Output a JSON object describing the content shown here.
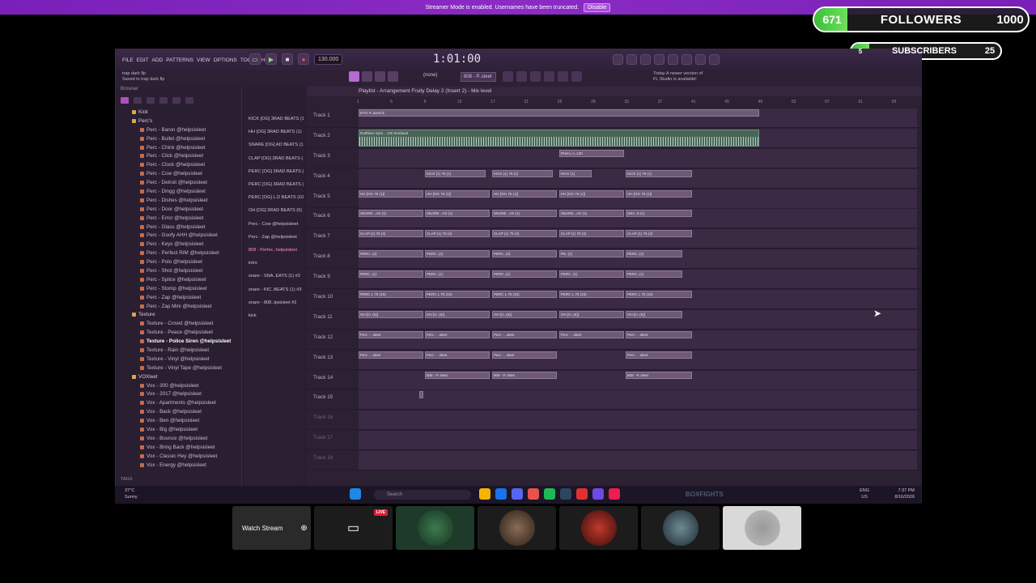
{
  "banner": {
    "text": "Streamer Mode is enabled. Usernames have been truncated.",
    "button": "Disable"
  },
  "followers": {
    "count": "671",
    "label": "FOLLOWERS",
    "goal": "1000",
    "progress": 0.671
  },
  "subscribers": {
    "count": "5",
    "label": "SUBSCRIBERS",
    "goal": "25",
    "progress": 0.2
  },
  "menu": [
    "FILE",
    "EDIT",
    "ADD",
    "PATTERNS",
    "VIEW",
    "OPTIONS",
    "TOOLS",
    "HELP"
  ],
  "transport": {
    "tempo": "130.000",
    "time": "1:01:00",
    "pattern": "808 - P..sleet",
    "snap": "(none)"
  },
  "hint": {
    "line1": "trap dark flp",
    "line2": "Saved to trap dark flp"
  },
  "news": {
    "line1": "Today  A newer version of",
    "line2": "FL Studio is available!"
  },
  "playlist": {
    "title": "Playlist - Arrangement  Fruity Delay 2 (Insert 2) - Mix level"
  },
  "browser": {
    "header": "Browser",
    "footer": "TAGS",
    "items": [
      {
        "label": "Kick",
        "type": "folder"
      },
      {
        "label": "Perc's",
        "type": "folder"
      },
      {
        "label": "Perc - Baron @helpsisleet",
        "type": "file"
      },
      {
        "label": "Perc - Bullet @helpsisleet",
        "type": "file"
      },
      {
        "label": "Perc - Chink @helpsisleet",
        "type": "file"
      },
      {
        "label": "Perc - Click @helpsisleet",
        "type": "file"
      },
      {
        "label": "Perc - Clock @helpsisleet",
        "type": "file"
      },
      {
        "label": "Perc - Cow @helpsisleet",
        "type": "file"
      },
      {
        "label": "Perc - Detroit @helpsisleet",
        "type": "file"
      },
      {
        "label": "Perc - Dingg @helpsisleet",
        "type": "file"
      },
      {
        "label": "Perc - Dishes @helpsisleet",
        "type": "file"
      },
      {
        "label": "Perc - Door @helpsisleet",
        "type": "file"
      },
      {
        "label": "Perc - Error @helpsisleet",
        "type": "file"
      },
      {
        "label": "Perc - Glass @helpsisleet",
        "type": "file"
      },
      {
        "label": "Perc - Goofy AHH @helpsisleet",
        "type": "file"
      },
      {
        "label": "Perc - Keys @helpsisleet",
        "type": "file"
      },
      {
        "label": "Perc - Perfect RIM @helpsisleet",
        "type": "file"
      },
      {
        "label": "Perc - Polo @helpsisleet",
        "type": "file"
      },
      {
        "label": "Perc - Shot @helpsisleet",
        "type": "file"
      },
      {
        "label": "Perc - Splice @helpsisleet",
        "type": "file"
      },
      {
        "label": "Perc - Stomp @helpsisleet",
        "type": "file"
      },
      {
        "label": "Perc - Zap @helpsisleet",
        "type": "file"
      },
      {
        "label": "Perc - Zap Mini @helpsisleet",
        "type": "file"
      },
      {
        "label": "Texture",
        "type": "folder"
      },
      {
        "label": "Texture - Crowd @helpsisleet",
        "type": "file"
      },
      {
        "label": "Texture - Peace @helpsisleet",
        "type": "file"
      },
      {
        "label": "Texture - Police Siren @helpsisleet",
        "type": "selected"
      },
      {
        "label": "Texture - Rain @helpsisleet",
        "type": "file"
      },
      {
        "label": "Texture - Vinyl @helpsisleet",
        "type": "file"
      },
      {
        "label": "Texture - Vinyl Tape @helpsisleet",
        "type": "file"
      },
      {
        "label": "VOXleet",
        "type": "folder"
      },
      {
        "label": "Vox - 300 @helpsisleet",
        "type": "file"
      },
      {
        "label": "Vox - 2017 @helpsisleet",
        "type": "file"
      },
      {
        "label": "Vox - Apartments @helpsisleet",
        "type": "file"
      },
      {
        "label": "Vox - Back @helpsisleet",
        "type": "file"
      },
      {
        "label": "Vox - Ben @helpsisleet",
        "type": "file"
      },
      {
        "label": "Vox - Big @helpsisleet",
        "type": "file"
      },
      {
        "label": "Vox - Bounce @helpsisleet",
        "type": "file"
      },
      {
        "label": "Vox - Bring Back @helpsisleet",
        "type": "file"
      },
      {
        "label": "Vox - Classic Hey @helpsisleet",
        "type": "file"
      },
      {
        "label": "Vox - Energy @helpsisleet",
        "type": "file"
      }
    ]
  },
  "patterns": [
    "KICK [OG] 3RAD BEATS (1)",
    "HH [OG] 3RAD BEATS (1)",
    "SNARE [OG] AD BEATS (1)",
    "CLAP [OG] 3RAD BEATS (1)",
    "PERC [OG] 3RAD BEATS (2)",
    "PERC [OG] 3RAD BEATS (1)",
    "PERC [OG] L.D BEATS (10)",
    "OH [OG] 3RAD BEATS (6)",
    "Perc - Cow @helpsisleet",
    "Perc - Zap @helpsisleet",
    "808 - Perfec..helpsisleet",
    "intro",
    "snare - SNA..EATS (1) #2",
    "snare - KIC..BEATS (1) #3",
    "snare - 808..lpsisleet #2",
    "kick"
  ],
  "timeline": [
    "1",
    "5",
    "9",
    "13",
    "17",
    "21",
    "25",
    "29",
    "33",
    "37",
    "41",
    "45",
    "49",
    "53",
    "57",
    "61",
    "65"
  ],
  "tracks": [
    {
      "label": "Track 1",
      "clips": [
        [
          "DTG P..averick",
          0,
          495,
          "plain"
        ]
      ]
    },
    {
      "label": "Track 2",
      "clips": [
        [
          "Ruthless Synt... 130 Zembunt",
          0,
          495,
          "audio"
        ]
      ]
    },
    {
      "label": "Track 3",
      "clips": [
        [
          "Premi..n..130",
          248,
          80,
          "plain"
        ]
      ]
    },
    {
      "label": "Track 4",
      "clips": [
        [
          "KICK (1) 75 (1)",
          82,
          75,
          "plain"
        ],
        [
          "KICK (1) 75 (1)",
          165,
          75,
          "plain"
        ],
        [
          "KICK (1)",
          248,
          40,
          "plain"
        ],
        [
          "KICK (1) 75 (1)",
          330,
          82,
          "plain"
        ]
      ]
    },
    {
      "label": "Track 5",
      "clips": [
        [
          "HH [OG 75 (1)]",
          0,
          80,
          "plain"
        ],
        [
          "HH [OG 75 (1)]",
          82,
          80,
          "plain"
        ],
        [
          "HH [OG 75 (1)]",
          165,
          80,
          "plain"
        ],
        [
          "HH [OG 75 (1)]",
          248,
          80,
          "plain"
        ],
        [
          "HH [OG 75 (1)]",
          330,
          82,
          "plain"
        ]
      ]
    },
    {
      "label": "Track 6",
      "clips": [
        [
          "SNARE ..AS (1)",
          0,
          80,
          "plain"
        ],
        [
          "SNARE ..AS (1)",
          82,
          80,
          "plain"
        ],
        [
          "SNARE ..AS (1)",
          165,
          80,
          "plain"
        ],
        [
          "SNARE ..AS (1)",
          248,
          80,
          "plain"
        ],
        [
          "SNA..S (1)",
          330,
          82,
          "plain"
        ]
      ]
    },
    {
      "label": "Track 7",
      "clips": [
        [
          "CLAP (1) 75 (4)",
          0,
          80,
          "plain"
        ],
        [
          "CLAP (1) 75 (4)",
          82,
          80,
          "plain"
        ],
        [
          "CLAP (1) 75 (4)",
          165,
          80,
          "plain"
        ],
        [
          "CLAP (1) 75 (4)",
          248,
          80,
          "plain"
        ],
        [
          "CLAP (1) 75 (4)",
          330,
          82,
          "plain"
        ]
      ]
    },
    {
      "label": "Track 8",
      "clips": [
        [
          "PERC..(2)",
          0,
          80,
          "plain"
        ],
        [
          "PERC..(2)",
          82,
          80,
          "plain"
        ],
        [
          "PERC..(2)",
          165,
          80,
          "plain"
        ],
        [
          "PE..(2)",
          248,
          80,
          "plain"
        ],
        [
          "PERC..(2)",
          330,
          70,
          "plain"
        ]
      ]
    },
    {
      "label": "Track 9",
      "clips": [
        [
          "PERC..(1)",
          0,
          80,
          "plain"
        ],
        [
          "PERC..(1)",
          82,
          80,
          "plain"
        ],
        [
          "PERC..(1)",
          165,
          80,
          "plain"
        ],
        [
          "PERC..(1)",
          248,
          80,
          "plain"
        ],
        [
          "PERC..(1)",
          330,
          70,
          "plain"
        ]
      ]
    },
    {
      "label": "Track 10",
      "clips": [
        [
          "PERC L 75 (10)",
          0,
          80,
          "plain"
        ],
        [
          "PERC L 75 (10)",
          82,
          80,
          "plain"
        ],
        [
          "PERC L 75 (10)",
          165,
          80,
          "plain"
        ],
        [
          "PERC L 75 (10)",
          248,
          80,
          "plain"
        ],
        [
          "PERC L 75 (10)",
          330,
          82,
          "plain"
        ]
      ]
    },
    {
      "label": "Track 11",
      "clips": [
        [
          "OH [O..(6)]",
          0,
          80,
          "plain"
        ],
        [
          "OH [O..(6)]",
          82,
          80,
          "plain"
        ],
        [
          "OH [O..(6)]",
          165,
          80,
          "plain"
        ],
        [
          "OH [O..(6)]",
          248,
          80,
          "plain"
        ],
        [
          "OH [O..(6)]",
          330,
          70,
          "plain"
        ]
      ]
    },
    {
      "label": "Track 12",
      "clips": [
        [
          "Perc - ..sleet",
          0,
          80,
          "plain"
        ],
        [
          "Perc - ..sleet",
          82,
          80,
          "plain"
        ],
        [
          "Perc - ..sleet",
          165,
          80,
          "plain"
        ],
        [
          "Perc - ..sleet",
          248,
          80,
          "plain"
        ],
        [
          "Perc - ..sleet",
          330,
          82,
          "plain"
        ]
      ]
    },
    {
      "label": "Track 13",
      "clips": [
        [
          "Perc - ..sleet",
          0,
          80,
          "plain"
        ],
        [
          "Perc - ..sleet",
          82,
          80,
          "plain"
        ],
        [
          "Perc - ..sleet",
          165,
          80,
          "plain"
        ],
        [
          "Perc - ..sleet",
          330,
          82,
          "plain"
        ]
      ]
    },
    {
      "label": "Track 14",
      "clips": [
        [
          "808 - P..sleet",
          82,
          80,
          "plain"
        ],
        [
          "808 - P..sleet",
          165,
          80,
          "plain"
        ],
        [
          "808 - P..sleet",
          330,
          82,
          "plain"
        ]
      ]
    },
    {
      "label": "Track 15",
      "clips": [
        [
          "",
          75,
          5,
          "plain"
        ]
      ]
    },
    {
      "label": "Track 16",
      "clips": []
    },
    {
      "label": "Track 17",
      "clips": []
    },
    {
      "label": "Track 18",
      "clips": []
    }
  ],
  "taskbar": {
    "search": "Search",
    "weather_line1": "37°C",
    "weather_line2": "Sunny",
    "lang_line1": "ENG",
    "lang_line2": "US",
    "time": "7:37 PM",
    "date": "8/16/2026",
    "boxfights": "BOXFIGHTS"
  },
  "bottom": {
    "watch_label": "Watch Stream",
    "live_badge": "LIVE"
  },
  "colors": {
    "accent": "#8a2cc4",
    "progress_green": "#4fcf4a",
    "track_bg": "#3a2a43"
  }
}
